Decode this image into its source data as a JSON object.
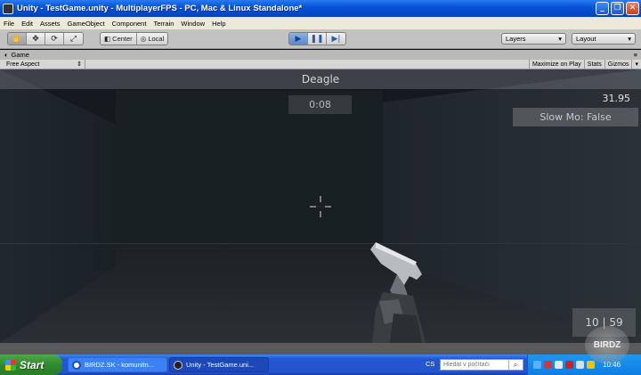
{
  "window": {
    "title": "Unity - TestGame.unity - MultiplayerFPS - PC, Mac & Linux Standalone*",
    "minimize": "_",
    "maximize": "❐",
    "close": "✕"
  },
  "menu": [
    "File",
    "Edit",
    "Assets",
    "GameObject",
    "Component",
    "Terrain",
    "Window",
    "Help"
  ],
  "toolbar": {
    "pivot_label": "Center",
    "space_label": "Local",
    "layers_label": "Layers",
    "layout_label": "Layout",
    "play_active": true
  },
  "game_view": {
    "tab_label": "Game",
    "aspect_label": "Free Aspect",
    "maximize_on_play": "Maximize on Play",
    "stats": "Stats",
    "gizmos": "Gizmos"
  },
  "hud": {
    "weapon_name": "Deagle",
    "timer": "0:08",
    "fps": "31.95",
    "slow_mo": "Slow Mo: False",
    "ammo": "10 | 59"
  },
  "taskbar": {
    "start_label": "Start",
    "tasks": [
      {
        "label": "BIRDZ.SK - komunitn...",
        "icon_color": "#ffffff"
      },
      {
        "label": "Unity - TestGame.uni...",
        "icon_color": "#222222"
      }
    ],
    "language": "CS",
    "search_placeholder": "Hledat v počítači",
    "clock": "10:46"
  },
  "watermark": "BIRDZ"
}
